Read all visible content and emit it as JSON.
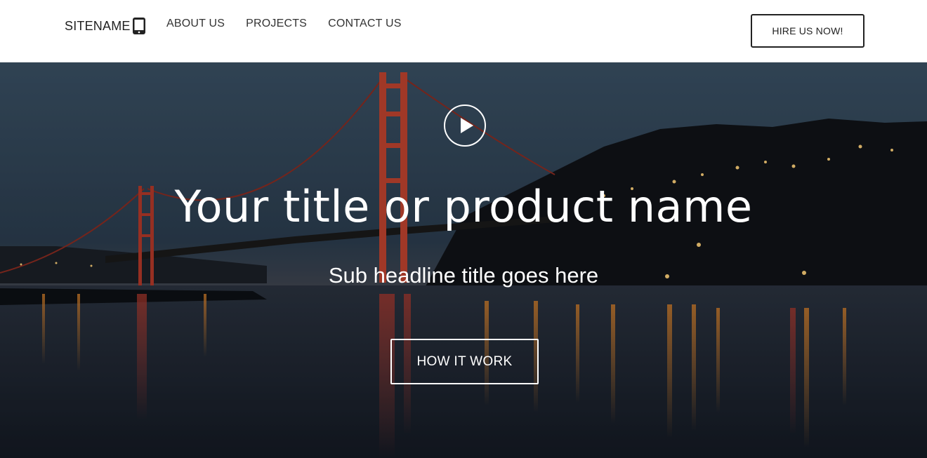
{
  "header": {
    "brand": "SITENAME",
    "brand_icon": "tablet-icon",
    "nav": [
      {
        "label": "ABOUT US"
      },
      {
        "label": "PROJECTS"
      },
      {
        "label": "CONTACT US"
      }
    ],
    "cta_label": "HIRE US NOW!"
  },
  "hero": {
    "background": "night photo of a suspension bridge over water with city lights",
    "play_icon": "play-icon",
    "title": "Your title or product name",
    "subtitle": "Sub headline title goes here",
    "button_label": "HOW IT WORK"
  },
  "colors": {
    "text_dark": "#222222",
    "hero_text": "#ffffff",
    "bridge": "#c0392b"
  }
}
